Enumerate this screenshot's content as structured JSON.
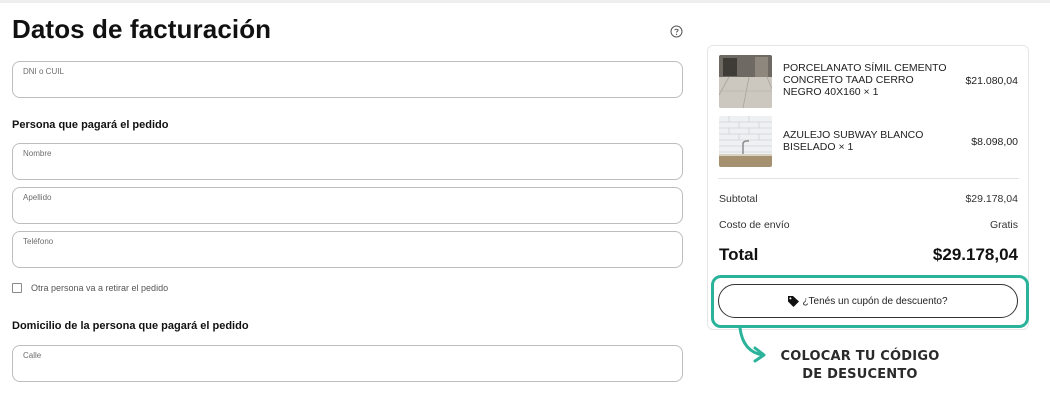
{
  "form": {
    "title": "Datos de facturación",
    "help_icon": "question-circle-icon",
    "dni_label": "DNI o CUIL",
    "payer_heading": "Persona que pagará el pedido",
    "nombre_label": "Nombre",
    "apellido_label": "Apellido",
    "telefono_label": "Teléfono",
    "other_person_checkbox": {
      "label": "Otra persona va a retirar el pedido",
      "checked": false
    },
    "address_heading": "Domicilio de la persona que pagará el pedido",
    "calle_label": "Calle"
  },
  "summary": {
    "items": [
      {
        "name": "PORCELANATO SÍMIL CEMENTO CONCRETO TAAD CERRO NEGRO 40X160 × 1",
        "price": "$21.080,04",
        "thumb_icon": "porcelain-tile-floor-thumbnail"
      },
      {
        "name": "AZULEJO SUBWAY BLANCO BISELADO × 1",
        "price": "$8.098,00",
        "thumb_icon": "subway-tile-wall-thumbnail"
      }
    ],
    "subtotal_label": "Subtotal",
    "subtotal_value": "$29.178,04",
    "shipping_label": "Costo de envío",
    "shipping_value": "Gratis",
    "total_label": "Total",
    "total_value": "$29.178,04",
    "coupon_label": "¿Tenés un cupón de descuento?",
    "coupon_icon": "tag-icon"
  },
  "annotation": {
    "callout_line1": "COLOCAR TU CÓDIGO",
    "callout_line2": "DE DESUCENTO",
    "accent_color": "#2ab39a"
  }
}
